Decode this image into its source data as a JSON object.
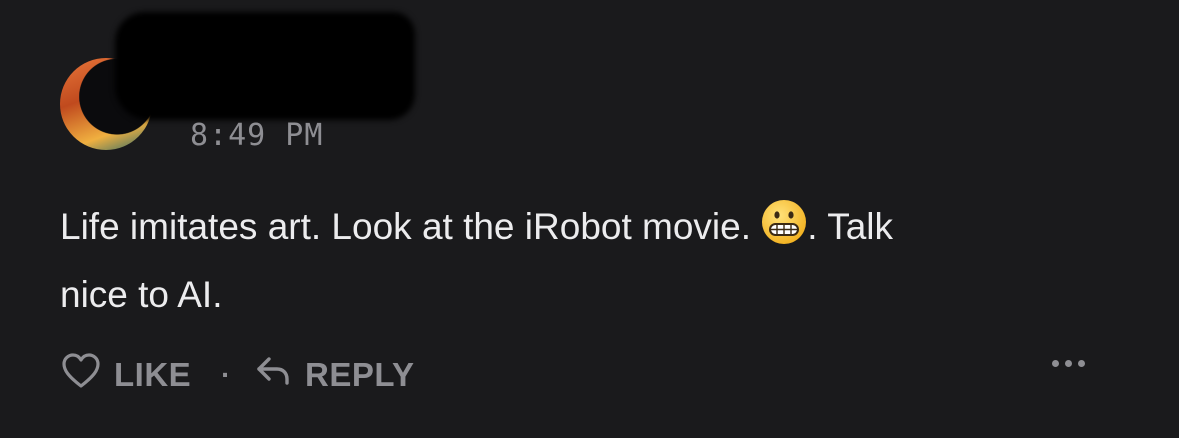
{
  "comment": {
    "timestamp": "8:49 PM",
    "text_line1": "Life imitates art.  Look at the iRobot movie. ",
    "emoji": "grimacing-face-icon",
    "text_line1_after": ".  Talk",
    "text_line2": "nice to AI."
  },
  "actions": {
    "like_label": "LIKE",
    "separator": "·",
    "reply_label": "REPLY"
  },
  "icons": {
    "like": "heart-outline-icon",
    "reply": "reply-arrow-icon",
    "more": "more-dots-icon"
  },
  "colors": {
    "background": "#1a1a1c",
    "text": "#ececee",
    "muted": "#8e8e93"
  }
}
